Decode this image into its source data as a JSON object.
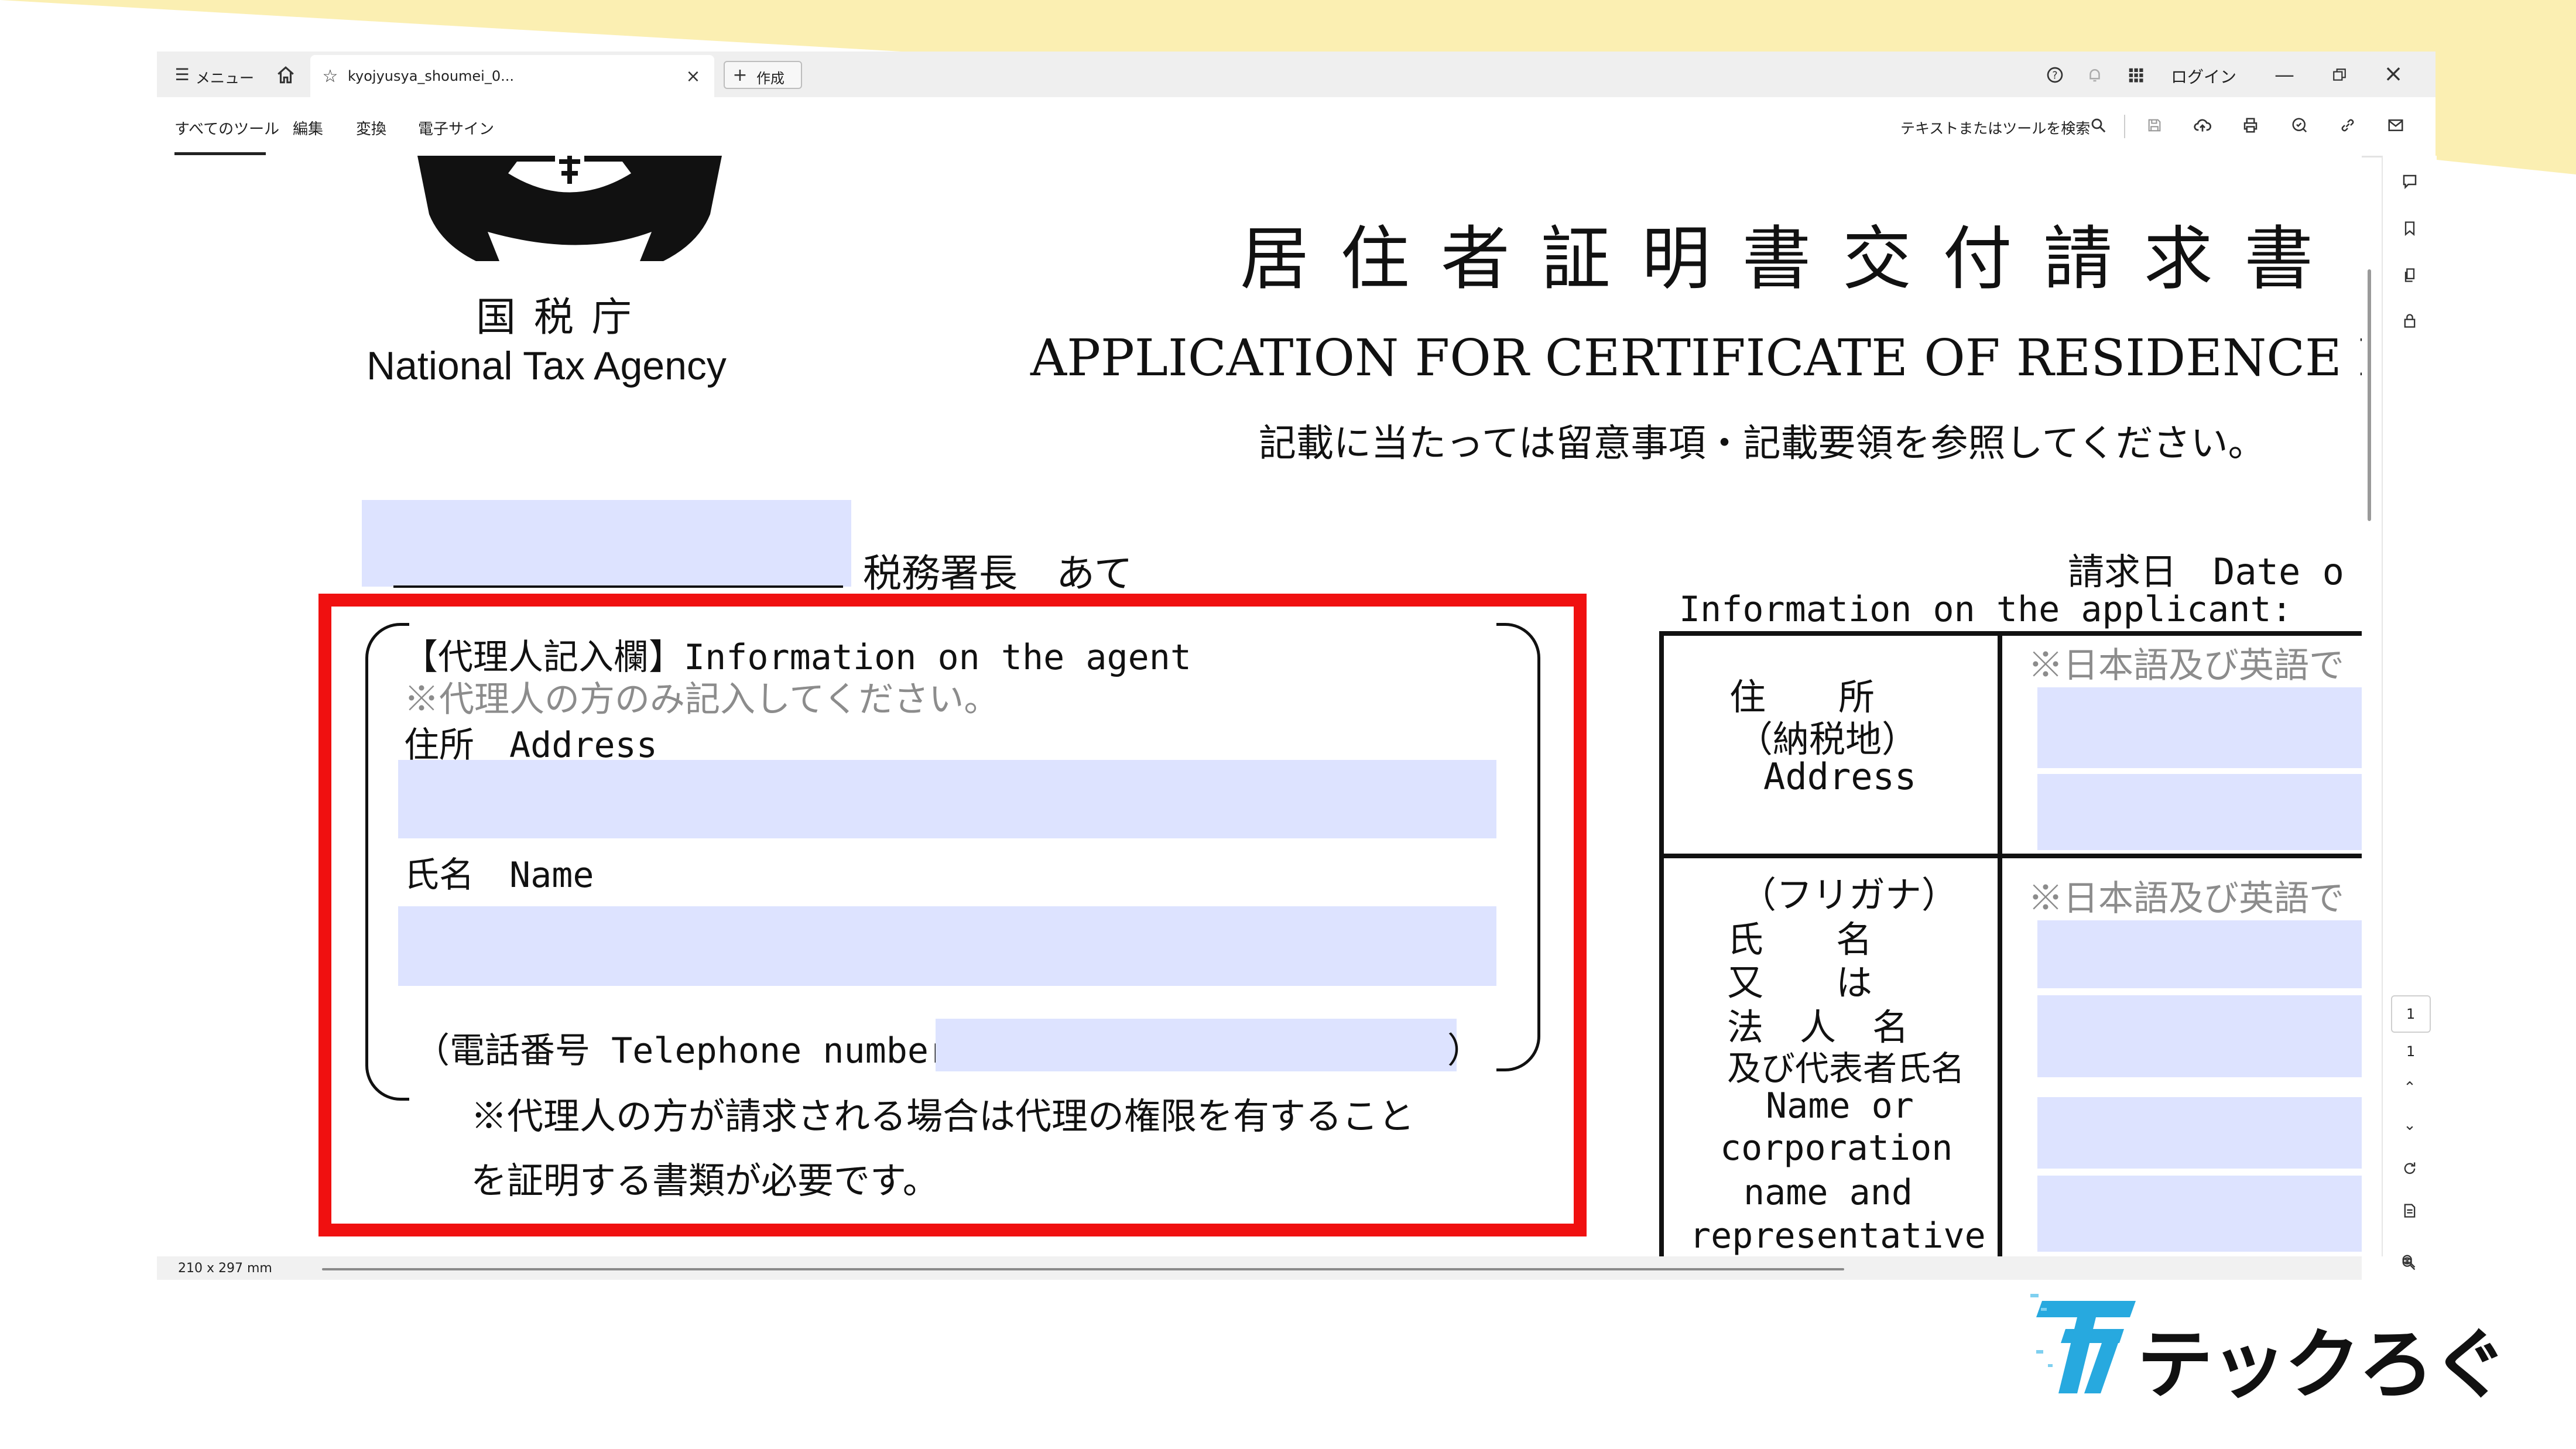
{
  "app": {
    "menu_label": "メニュー",
    "tab_title": "kyojyusya_shoumei_0...",
    "new_tab_label": "作成",
    "login_label": "ログイン",
    "tools": [
      "すべてのツール",
      "編集",
      "変換",
      "電子サイン"
    ],
    "search_label": "テキストまたはツールを検索",
    "page_size": "210 x 297 mm",
    "page_current": "1",
    "page_total": "1"
  },
  "document": {
    "agency_jp": "国 税 庁",
    "agency_en": "National Tax Agency",
    "title_jp": "居 住 者 証 明 書 交 付 請 求 書",
    "title_en": "APPLICATION FOR CERTIFICATE OF RESIDENCE I",
    "notice": "記載に当たっては留意事項・記載要領を参照してください。",
    "tax_office_label": "税務署長　あて",
    "request_date_label": "請求日　Date o",
    "applicant_info": "Information on the applicant:",
    "agent_section": {
      "heading": "【代理人記入欄】Information on the agent",
      "note": "※代理人の方のみ記入してください。",
      "address_label": "住所　Address",
      "name_label": "氏名　Name",
      "phone_label": "（電話番号 Telephone number",
      "phone_close": "）",
      "footnote_1": "※代理人の方が請求される場合は代理の権限を有すること",
      "footnote_2": "を証明する書類が必要です。"
    },
    "applicant_table": {
      "address_label": [
        "住　　所",
        "（納税地）",
        "Address"
      ],
      "address_note": "※日本語及び英語で",
      "name_label": [
        "（フリガナ）",
        "氏　　名",
        "又　　は",
        "法　人　名",
        "及び代表者氏名",
        "Name or",
        "corporation",
        "name and",
        "representative"
      ],
      "name_note": "※日本語及び英語で"
    }
  },
  "brand": {
    "logo_text": "テックろぐ"
  },
  "colors": {
    "highlight_red": "#f01010",
    "field_blue": "#dde3ff",
    "deco_yellow": "#fbefb2",
    "tool_active_blue": "#1b6fd8"
  }
}
